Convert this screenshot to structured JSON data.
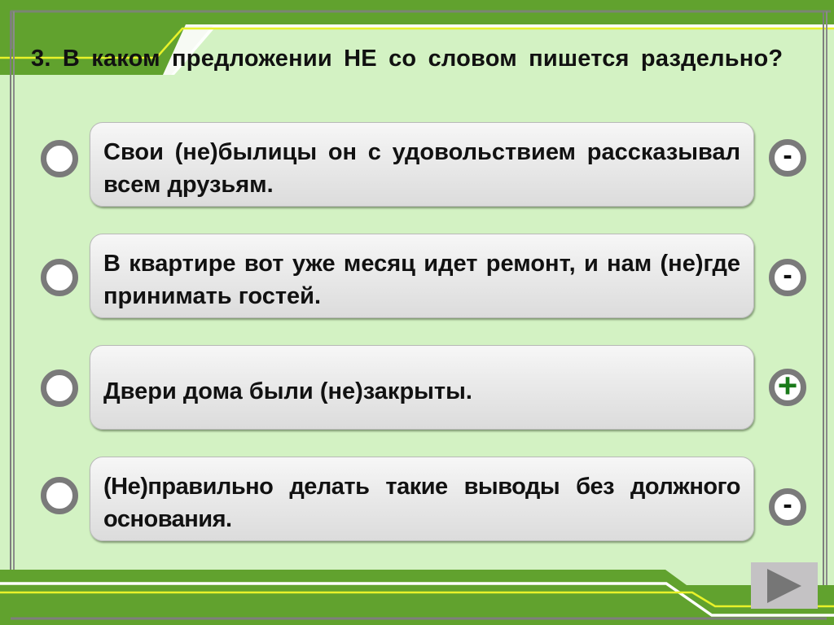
{
  "question": {
    "text": "3. В каком предложении НЕ со словом пишется раздельно?"
  },
  "answers": [
    {
      "text": "Свои (не)былицы он с удовольствием рассказывал всем друзьям.",
      "mark": "-",
      "correct": false
    },
    {
      "text": "В квартире вот уже месяц идет ремонт, и нам (не)где принимать гостей.",
      "mark": "-",
      "correct": false
    },
    {
      "text": "Двери дома были (не)закрыты.",
      "mark": "+",
      "correct": true
    },
    {
      "text": "(Не)правильно делать такие выводы без должного основания.",
      "mark": "-",
      "correct": false
    }
  ],
  "navigation": {
    "next_icon": "play-triangle-icon"
  },
  "colors": {
    "background": "#d3f2c3",
    "band_green": "#61a22e",
    "accent_yellow": "#e8f22a",
    "frame_gray": "#7a7a7a",
    "correct_green": "#1a7a1a"
  }
}
